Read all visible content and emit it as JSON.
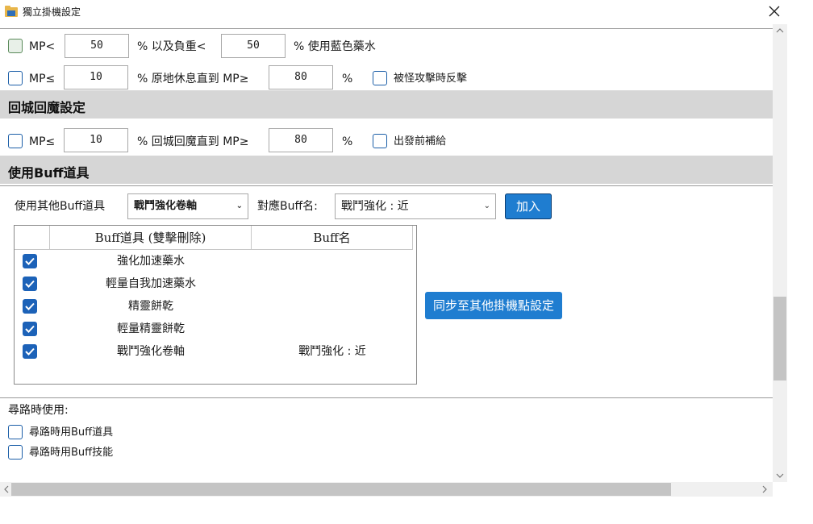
{
  "window": {
    "title": "獨立掛機設定",
    "close_symbol": "✕"
  },
  "mp_potion_row": {
    "prefix": "MP<",
    "value1": "50",
    "mid_label": "% 以及負重<",
    "value2": "50",
    "suffix": "% 使用藍色藥水"
  },
  "mp_rest_row": {
    "prefix": "MP≤",
    "value1": "10",
    "mid_label": "% 原地休息直到 MP≥",
    "value2": "80",
    "suffix": "%",
    "counter_label": "被怪攻擊時反擊"
  },
  "town_section": {
    "title": "回城回魔設定",
    "prefix": "MP≤",
    "value1": "10",
    "mid_label": "% 回城回魔直到 MP≥",
    "value2": "80",
    "suffix": "%",
    "resupply_label": "出發前補給"
  },
  "buff_section": {
    "title": "使用Buff道具",
    "other_item_label": "使用其他Buff道具",
    "item_select": "戰鬥強化卷軸",
    "buff_name_label": "對應Buff名:",
    "buff_select": "戰鬥強化 : 近",
    "add_button": "加入",
    "sync_button": "同步至其他掛機點設定",
    "table": {
      "col_item": "Buff道具 (雙擊刪除)",
      "col_buff": "Buff名",
      "rows": [
        {
          "item": "強化加速藥水",
          "buff": "",
          "checked": true
        },
        {
          "item": "輕量自我加速藥水",
          "buff": "",
          "checked": true
        },
        {
          "item": "精靈餅乾",
          "buff": "",
          "checked": true
        },
        {
          "item": "輕量精靈餅乾",
          "buff": "",
          "checked": true
        },
        {
          "item": "戰鬥強化卷軸",
          "buff": "戰鬥強化 : 近",
          "checked": true
        }
      ]
    }
  },
  "pathing_section": {
    "title": "尋路時使用:",
    "use_buff_item": "尋路時用Buff道具",
    "use_buff_skill": "尋路時用Buff技能"
  },
  "colors": {
    "accent": "#1f7dd0",
    "section_bg": "#d6d6d6",
    "checkbox_border": "#1c5fa8"
  }
}
